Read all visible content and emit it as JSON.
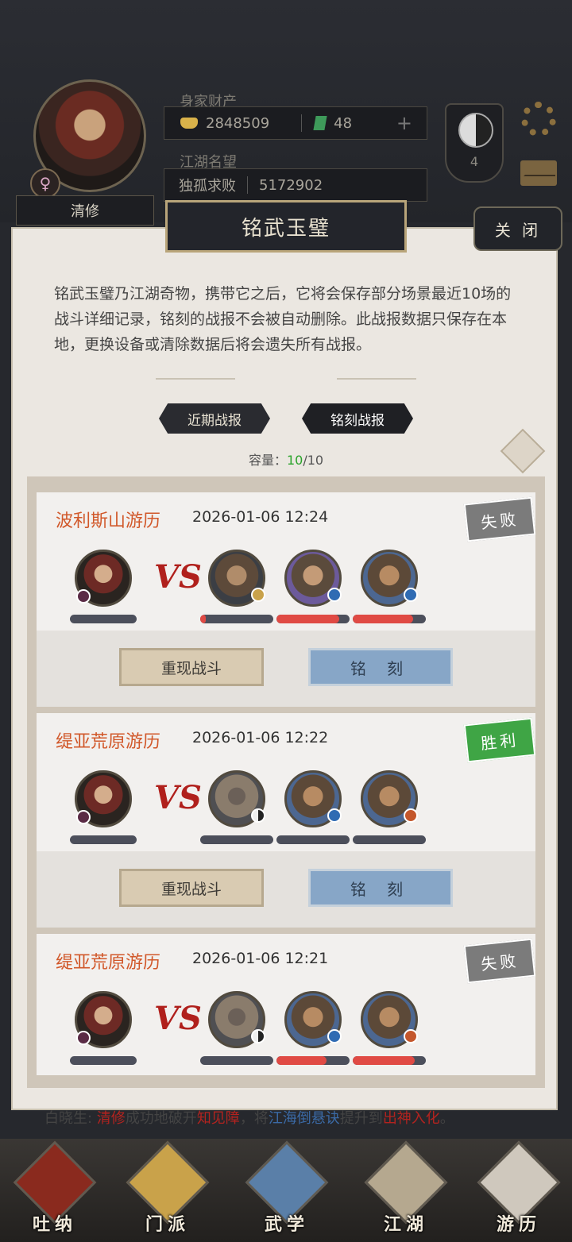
{
  "header": {
    "player_name": "清修",
    "gender_symbol": "♀",
    "wealth_label": "身家财产",
    "silver": "2848509",
    "jade": "48",
    "fame_label": "江湖名望",
    "fame_title": "独孤求败",
    "fame_value": "5172902",
    "level_badge": "4"
  },
  "dialog": {
    "title": "铭武玉璧",
    "close_label": "关 闭",
    "intro": "铭武玉璧乃江湖奇物，携带它之后，它将会保存部分场景最近10场的战斗详细记录，铭刻的战报不会被自动删除。此战报数据只保存在本地，更换设备或清除数据后将会遗失所有战报。",
    "tabs": [
      "近期战报",
      "铭刻战报"
    ],
    "capacity_label": "容量：",
    "capacity_used": "10",
    "capacity_total": "/10",
    "replay_label": "重现战斗",
    "engrave_label": "铭 刻",
    "vs_text": "VS"
  },
  "records": [
    {
      "location": "波利斯山游历",
      "time": "2026-01-06 12:24",
      "result": "失败",
      "player_hp": 0,
      "enemies": [
        {
          "portrait": "fur-hat-warrior",
          "badge": "gold-icon",
          "hp": 0.08
        },
        {
          "portrait": "mustached-man",
          "badge": "blue-icon",
          "hp": 0.86
        },
        {
          "portrait": "tribal-man",
          "badge": "blue-icon",
          "hp": 0.83
        }
      ]
    },
    {
      "location": "缇亚荒原游历",
      "time": "2026-01-06 12:22",
      "result": "胜利",
      "player_hp": 0,
      "enemies": [
        {
          "portrait": "hooded-masked-man",
          "badge": "taiji-icon",
          "hp": 0
        },
        {
          "portrait": "tribal-man",
          "badge": "blue-icon",
          "hp": 0
        },
        {
          "portrait": "tribal-man",
          "badge": "fire-icon",
          "hp": 0
        }
      ]
    },
    {
      "location": "缇亚荒原游历",
      "time": "2026-01-06 12:21",
      "result": "失败",
      "player_hp": 0,
      "enemies": [
        {
          "portrait": "hooded-masked-man",
          "badge": "taiji-icon",
          "hp": 0
        },
        {
          "portrait": "tribal-man",
          "badge": "blue-icon",
          "hp": 0.68
        },
        {
          "portrait": "tribal-man",
          "badge": "fire-icon",
          "hp": 0.85
        }
      ]
    }
  ],
  "news": {
    "p1": "白晓生:",
    "name": "清修",
    "p2": "成功地破开",
    "item1": "知见障",
    "p3": "，将",
    "skill": "江海倒悬诀",
    "p4": "提升到",
    "rank": "出神入化",
    "p5": "。"
  },
  "nav": [
    "吐纳",
    "门派",
    "武学",
    "江湖",
    "游历"
  ],
  "colors": {
    "location_text": "#d1582a",
    "win_stamp": "#3fa545",
    "lose_stamp": "#7b7b7b",
    "hp_fill": "#e04a44",
    "capacity_used": "#2aa32a"
  }
}
